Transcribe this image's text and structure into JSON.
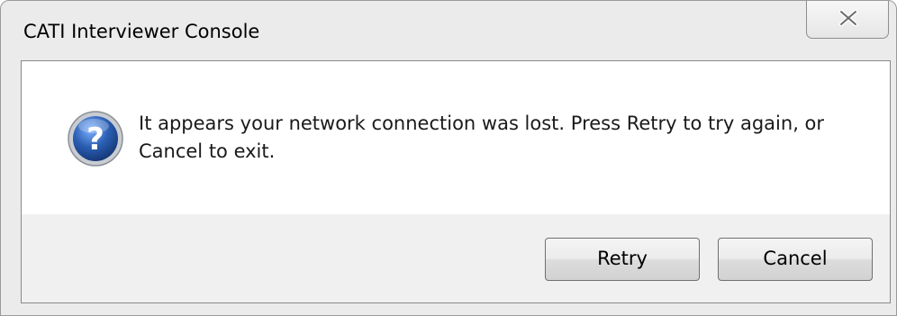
{
  "window": {
    "title": "CATI Interviewer Console"
  },
  "dialog": {
    "icon": "question-icon",
    "message": "It appears your network connection was lost. Press Retry to try again, or Cancel to exit."
  },
  "buttons": {
    "retry_label": "Retry",
    "cancel_label": "Cancel",
    "close_icon": "close-icon"
  },
  "colors": {
    "icon_blue": "#2b5fb4",
    "panel_white": "#ffffff",
    "footer_gray": "#f0f0f0"
  }
}
